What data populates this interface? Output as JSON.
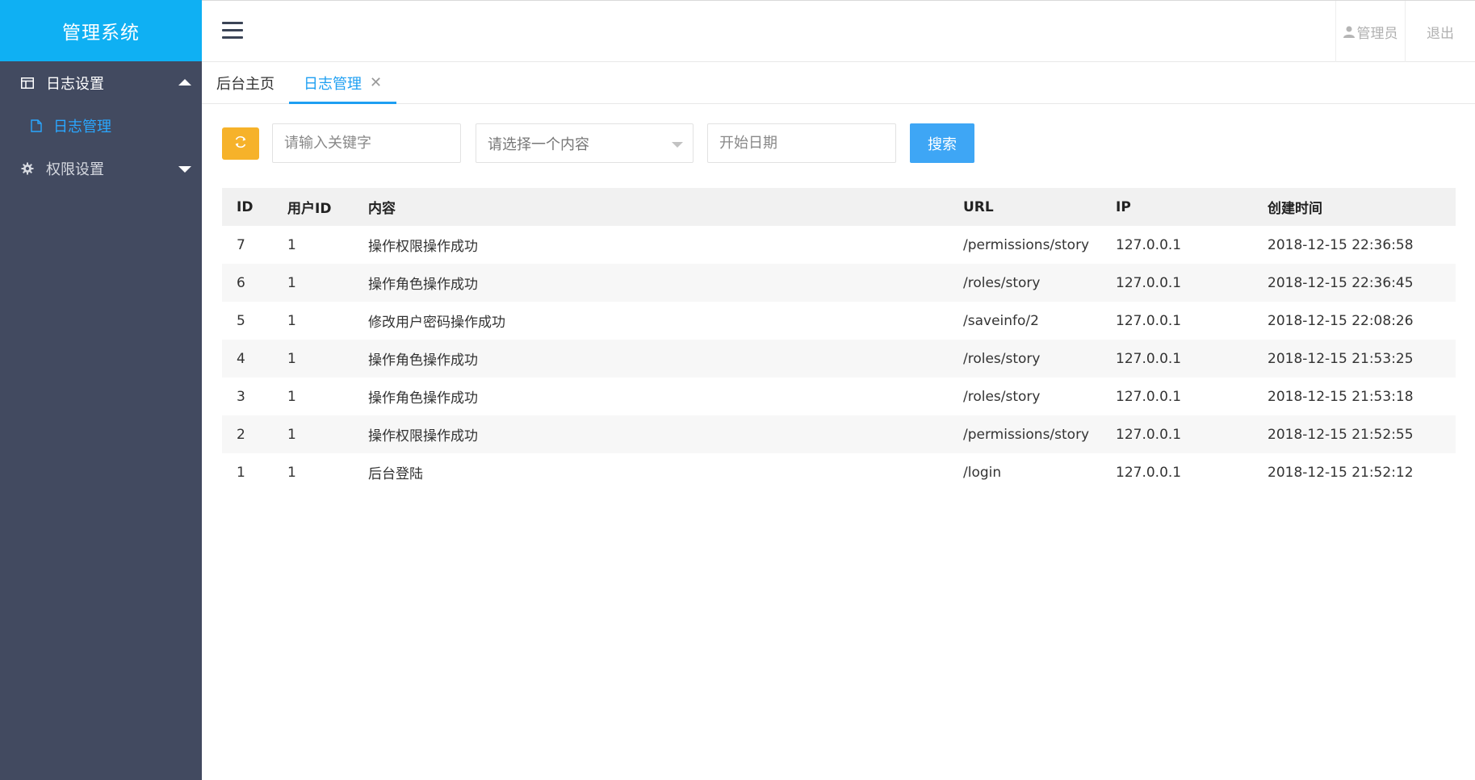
{
  "app": {
    "title": "管理系统"
  },
  "sidebar": {
    "groups": [
      {
        "label": "日志设置",
        "icon": "table-icon",
        "expanded": true,
        "items": [
          {
            "label": "日志管理",
            "icon": "file-icon",
            "active": true
          }
        ]
      },
      {
        "label": "权限设置",
        "icon": "gear-icon",
        "expanded": false,
        "items": []
      }
    ]
  },
  "header": {
    "user_label": "管理员",
    "logout_label": "退出"
  },
  "tabs": [
    {
      "label": "后台主页",
      "active": false
    },
    {
      "label": "日志管理",
      "active": true,
      "closable": true
    }
  ],
  "toolbar": {
    "keyword_placeholder": "请输入关键字",
    "select_placeholder": "请选择一个内容",
    "date_placeholder": "开始日期",
    "search_label": "搜索"
  },
  "table": {
    "columns": [
      "ID",
      "用户ID",
      "内容",
      "URL",
      "IP",
      "创建时间"
    ],
    "rows": [
      [
        "7",
        "1",
        "操作权限操作成功",
        "/permissions/story",
        "127.0.0.1",
        "2018-12-15 22:36:58"
      ],
      [
        "6",
        "1",
        "操作角色操作成功",
        "/roles/story",
        "127.0.0.1",
        "2018-12-15 22:36:45"
      ],
      [
        "5",
        "1",
        "修改用户密码操作成功",
        "/saveinfo/2",
        "127.0.0.1",
        "2018-12-15 22:08:26"
      ],
      [
        "4",
        "1",
        "操作角色操作成功",
        "/roles/story",
        "127.0.0.1",
        "2018-12-15 21:53:25"
      ],
      [
        "3",
        "1",
        "操作角色操作成功",
        "/roles/story",
        "127.0.0.1",
        "2018-12-15 21:53:18"
      ],
      [
        "2",
        "1",
        "操作权限操作成功",
        "/permissions/story",
        "127.0.0.1",
        "2018-12-15 21:52:55"
      ],
      [
        "1",
        "1",
        "后台登陆",
        "/login",
        "127.0.0.1",
        "2018-12-15 21:52:12"
      ]
    ]
  },
  "colors": {
    "logo_bg": "#0fb0f3",
    "sidebar_bg": "#424a60",
    "active_blue": "#1e9ff2",
    "refresh_btn": "#f6b22a",
    "search_btn": "#3ea6f5"
  }
}
